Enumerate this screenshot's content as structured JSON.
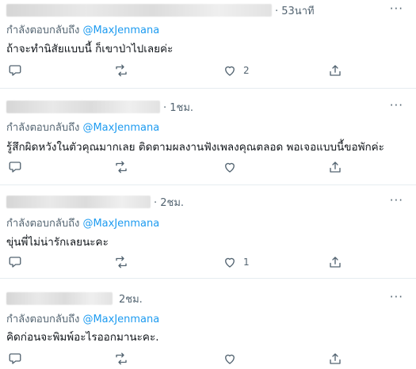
{
  "replies": [
    {
      "time": "· 53นาที",
      "replying_label": "กำลังตอบกลับถึง",
      "replying_handle": "@MaxJenmana",
      "text": "ถ้าจะทำนิสัยแบบนี้ ก็เขาป่าไปเลยค่ะ",
      "like_count": "2",
      "more": "···"
    },
    {
      "time": "· 1ชม.",
      "replying_label": "กำลังตอบกลับถึง",
      "replying_handle": "@MaxJenmana",
      "text": "รู้สึกผิดหวังในตัวคุณมากเลย ติดตามผลงานฟังเพลงคุณตลอด พอเจอแบบนี้ขอพักค่ะ",
      "like_count": "",
      "more": "···"
    },
    {
      "time": "· 2ชม.",
      "replying_label": "กำลังตอบกลับถึง",
      "replying_handle": "@MaxJenmana",
      "text": "ขุ่นพี่ไม่น่ารักเลยนะคะ",
      "like_count": "1",
      "more": "···"
    },
    {
      "time": "2ชม.",
      "replying_label": "กำลังตอบกลับถึง",
      "replying_handle": "@MaxJenmana",
      "text": "คิดก่อนจะพิมพ์อะไรออกมานะคะ.",
      "like_count": "",
      "more": "···"
    }
  ],
  "icons": {
    "reply": "comment-icon",
    "retweet": "retweet-icon",
    "like": "heart-icon",
    "share": "share-icon",
    "more": "more-icon"
  },
  "colors": {
    "link": "#1d9bf0",
    "secondary": "#536471",
    "text": "#0f1419",
    "divider": "#e6ecf0"
  }
}
